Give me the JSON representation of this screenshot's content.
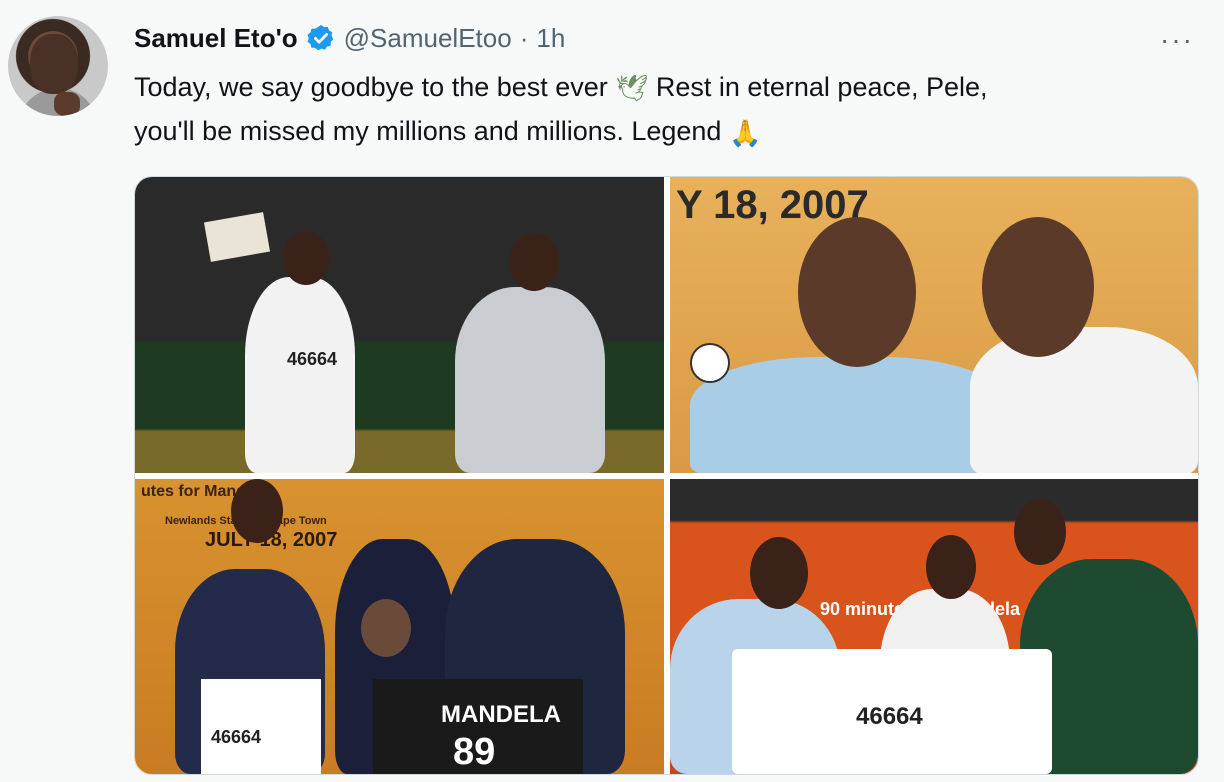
{
  "tweet": {
    "author_name": "Samuel Eto'o",
    "handle": "@SamuelEtoo",
    "separator": "·",
    "time": "1h",
    "more_label": "···",
    "text_line1_a": "Today, we say goodbye to the best ever",
    "text_line1_b": "Rest in eternal peace, Pele,",
    "text_line2": "you'll be missed my millions and millions. Legend",
    "emoji_dove": "🕊",
    "emoji_pray": "🙏"
  },
  "photos": {
    "p1_shirt_number": "46664",
    "p2_banner": "Y 18, 2007",
    "p3_banner": "utes for Mandela",
    "p3_banner_sub": "Newlands Stadium, Cape Town",
    "p3_year": "JULY 18, 2007",
    "p3_jersey_name": "MANDELA",
    "p3_jersey_number": "89",
    "p3_left_shirt_number": "46664",
    "p4_banner": "90 minutes for Mandela",
    "p4_shirt_number": "46664"
  },
  "colors": {
    "verified": "#1d9bf0",
    "text": "#0f1419",
    "secondary": "#536471"
  }
}
